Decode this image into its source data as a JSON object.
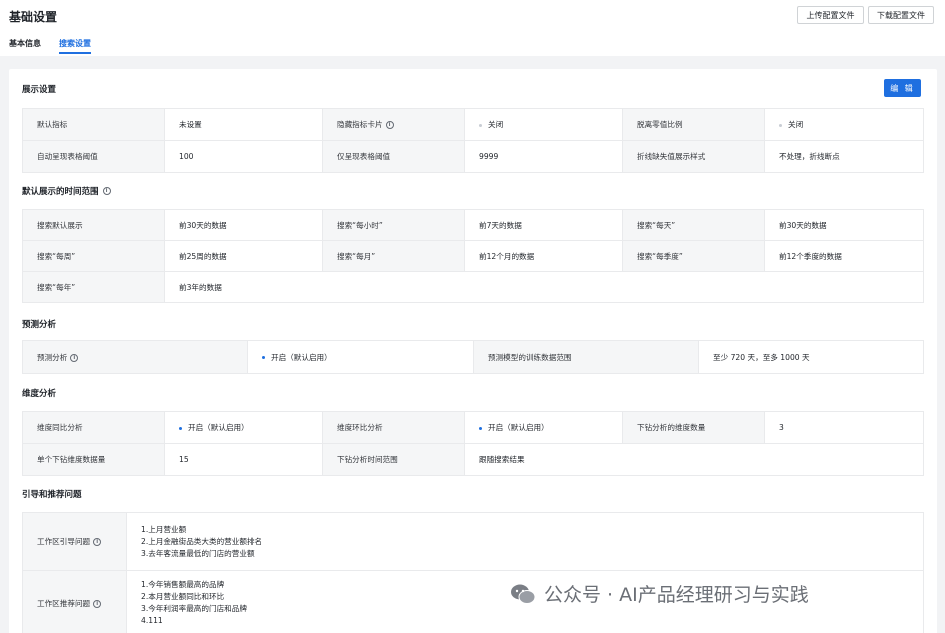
{
  "header": {
    "title": "基础设置",
    "upload_label": "上传配置文件",
    "download_label": "下载配置文件",
    "tabs": [
      "基本信息",
      "搜索设置"
    ]
  },
  "display": {
    "title": "展示设置",
    "edit_label": "编 辑",
    "rows": [
      [
        {
          "k": "默认指标",
          "v": "未设置",
          "muted": true
        },
        {
          "k": "隐藏指标卡片",
          "info": true,
          "v": "关闭",
          "dot": "grey"
        },
        {
          "k": "脱离零值比例",
          "v": "关闭",
          "dot": "grey"
        }
      ],
      [
        {
          "k": "自动呈现表格阈值",
          "v": "100"
        },
        {
          "k": "仅呈现表格阈值",
          "v": "9999"
        },
        {
          "k": "折线缺失值展示样式",
          "v": "不处理，折线断点"
        }
      ]
    ]
  },
  "time_range": {
    "title": "默认展示的时间范围",
    "rows": [
      [
        {
          "k": "搜索默认展示",
          "v": "前30天的数据"
        },
        {
          "k": "搜索“每小时”",
          "v": "前7天的数据"
        },
        {
          "k": "搜索“每天”",
          "v": "前30天的数据"
        }
      ],
      [
        {
          "k": "搜索“每周”",
          "v": "前25周的数据"
        },
        {
          "k": "搜索“每月”",
          "v": "前12个月的数据"
        },
        {
          "k": "搜索“每季度”",
          "v": "前12个季度的数据"
        }
      ],
      [
        {
          "k": "搜索“每年”",
          "v": "前3年的数据"
        }
      ]
    ]
  },
  "forecast": {
    "title": "预测分析",
    "row": [
      {
        "k": "预测分析",
        "info": true,
        "v": "开启（默认启用）",
        "dot": "blue"
      },
      {
        "k": "预测模型的训练数据范围",
        "v": "至少 720 天，至多 1000 天"
      }
    ]
  },
  "dimension": {
    "title": "维度分析",
    "rows": [
      [
        {
          "k": "维度同比分析",
          "v": "开启（默认启用）",
          "dot": "blue"
        },
        {
          "k": "维度环比分析",
          "v": "开启（默认启用）",
          "dot": "blue"
        },
        {
          "k": "下钻分析的维度数量",
          "v": "3"
        }
      ],
      [
        {
          "k": "单个下钻维度数据量",
          "v": "15"
        },
        {
          "k": "下钻分析时间范围",
          "v": "跟随搜索结果"
        }
      ]
    ]
  },
  "guide": {
    "title": "引导和推荐问题",
    "rows": [
      {
        "k": "工作区引导问题",
        "items": [
          "1.上月营业额",
          "2.上月金融街品类大类的营业额排名",
          "3.去年客流量最低的门店的营业额"
        ]
      },
      {
        "k": "工作区推荐问题",
        "items": [
          "1.今年销售额最高的品牌",
          "2.本月营业额同比和环比",
          "3.今年利润率最高的门店和品牌",
          "4.111"
        ]
      }
    ]
  },
  "watermark": "公众号 · AI产品经理研习与实践"
}
